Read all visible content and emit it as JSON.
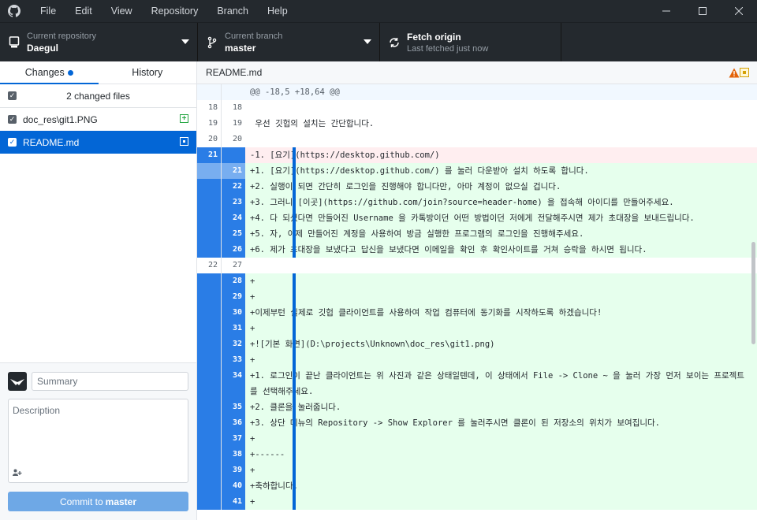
{
  "menu": [
    "File",
    "Edit",
    "View",
    "Repository",
    "Branch",
    "Help"
  ],
  "toolbar": {
    "repo_desc": "Current repository",
    "repo_name": "Daegul",
    "branch_desc": "Current branch",
    "branch_name": "master",
    "fetch_title": "Fetch origin",
    "fetch_desc": "Last fetched just now"
  },
  "tabs": {
    "changes": "Changes",
    "history": "History"
  },
  "changes": {
    "header": "2 changed files",
    "files": [
      {
        "path": "doc_res\\git1.PNG",
        "status": "added"
      },
      {
        "path": "README.md",
        "status": "modified"
      }
    ]
  },
  "commit": {
    "summary_placeholder": "Summary",
    "description_placeholder": "Description",
    "button_prefix": "Commit to",
    "button_branch": "master"
  },
  "diff": {
    "file": "README.md",
    "rows": [
      {
        "t": "hunk",
        "o": "",
        "n": "",
        "c": "@@ -18,5 +18,64 @@"
      },
      {
        "t": "ctx",
        "o": "18",
        "n": "18",
        "c": ""
      },
      {
        "t": "ctx",
        "o": "19",
        "n": "19",
        "c": " 우선 깃헙의 설치는 간단합니다."
      },
      {
        "t": "ctx",
        "o": "20",
        "n": "20",
        "c": ""
      },
      {
        "t": "del",
        "o": "21",
        "n": "",
        "c": "-1. [요기](https://desktop.github.com/)"
      },
      {
        "t": "add lite",
        "o": "",
        "n": "21",
        "c": "+1. [요기](https://desktop.github.com/) 를 눌러 다운받아 설치 하도록 합니다."
      },
      {
        "t": "add",
        "o": "",
        "n": "22",
        "c": "+2. 실행이 되면 간단히 로그인을 진행해야 합니다만, 아마 계정이 없으실 겁니다."
      },
      {
        "t": "add",
        "o": "",
        "n": "23",
        "c": "+3. 그러니 [이곳](https://github.com/join?source=header-home) 을 접속해 아이디를 만들어주세요."
      },
      {
        "t": "add",
        "o": "",
        "n": "24",
        "c": "+4. 다 되셨다면 만들어진 Username 을 카톡방이던 어떤 방법이던 저에게 전달해주시면 제가 초대장을 보내드립니다."
      },
      {
        "t": "add",
        "o": "",
        "n": "25",
        "c": "+5. 자, 이제 만들어진 계정을 사용하여 방금 실행한 프로그램의 로그인을 진행해주세요."
      },
      {
        "t": "add",
        "o": "",
        "n": "26",
        "c": "+6. 제가 초대장을 보냈다고 답신을 보냈다면 이메일을 확인 후 확인사이트를 거쳐 승락을 하시면 됩니다."
      },
      {
        "t": "ctx",
        "o": "22",
        "n": "27",
        "c": ""
      },
      {
        "t": "add",
        "o": "",
        "n": "28",
        "c": "+"
      },
      {
        "t": "add",
        "o": "",
        "n": "29",
        "c": "+"
      },
      {
        "t": "add",
        "o": "",
        "n": "30",
        "c": "+이제부턴 실제로 깃헙 클라이언트를 사용하여 작업 컴퓨터에 동기화를 시작하도록 하겠습니다!"
      },
      {
        "t": "add",
        "o": "",
        "n": "31",
        "c": "+"
      },
      {
        "t": "add",
        "o": "",
        "n": "32",
        "c": "+![기본 화면](D:\\projects\\Unknown\\doc_res\\git1.png)"
      },
      {
        "t": "add",
        "o": "",
        "n": "33",
        "c": "+"
      },
      {
        "t": "add",
        "o": "",
        "n": "34",
        "c": "+1. 로그인이 끝난 클라이언트는 위 사진과 같은 상태일텐데, 이 상태에서 File -> Clone ~ 을 눌러 가장 먼저 보이는 프로젝트를 선택해주세요."
      },
      {
        "t": "add",
        "o": "",
        "n": "35",
        "c": "+2. 클론을 눌러줍니다."
      },
      {
        "t": "add",
        "o": "",
        "n": "36",
        "c": "+3. 상단 메뉴의 Repository -> Show Explorer 를 눌러주시면 클론이 된 저장소의 위치가 보여집니다."
      },
      {
        "t": "add",
        "o": "",
        "n": "37",
        "c": "+"
      },
      {
        "t": "add",
        "o": "",
        "n": "38",
        "c": "+------"
      },
      {
        "t": "add",
        "o": "",
        "n": "39",
        "c": "+"
      },
      {
        "t": "add",
        "o": "",
        "n": "40",
        "c": "+축하합니다."
      },
      {
        "t": "add",
        "o": "",
        "n": "41",
        "c": "+"
      }
    ]
  }
}
